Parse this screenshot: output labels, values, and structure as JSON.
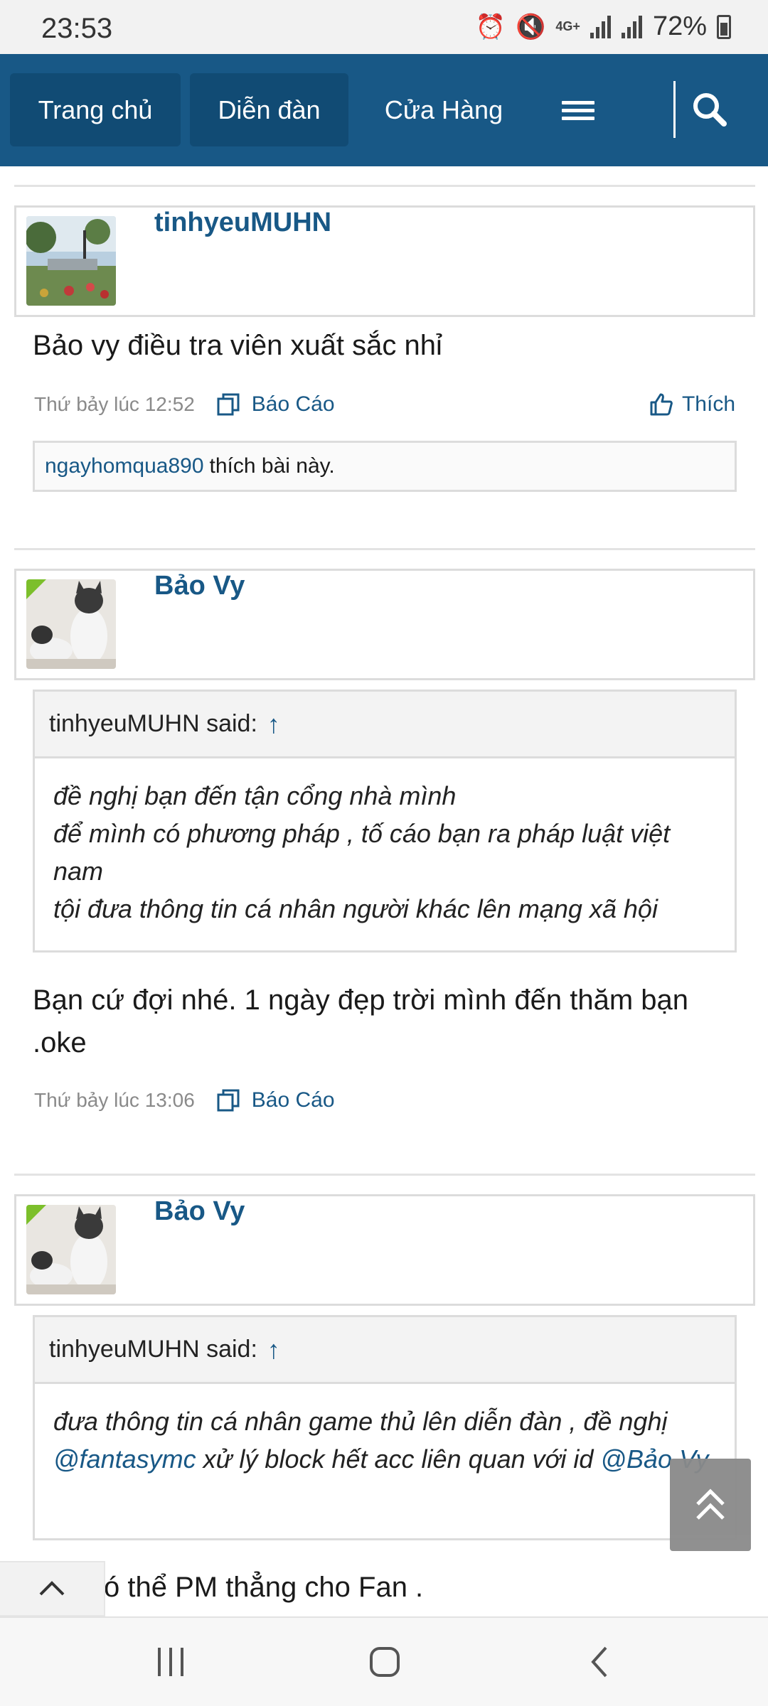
{
  "status_bar": {
    "time": "23:53",
    "network": "4G+",
    "battery": "72%",
    "icons": [
      "alarm-icon",
      "mute-icon",
      "data-icon",
      "signal-icon",
      "signal-icon",
      "battery-icon"
    ]
  },
  "nav": {
    "tabs": [
      {
        "label": "Trang chủ",
        "active": true
      },
      {
        "label": "Diễn đàn",
        "active": true
      },
      {
        "label": "Cửa Hàng",
        "active": false
      }
    ],
    "menu_icon": "hamburger-icon",
    "search_icon": "search-icon"
  },
  "posts": [
    {
      "username": "tinhyeuMUHN",
      "text": "Bảo vy điều tra viên xuất sắc nhỉ",
      "time": "Thứ bảy lúc 12:52",
      "report_label": "Báo Cáo",
      "like_label": "Thích",
      "likes": {
        "user": "ngayhomqua890",
        "text": "thích bài này."
      }
    },
    {
      "username": "Bảo Vy",
      "quote": {
        "author": "tinhyeuMUHN said:",
        "arrow": "↑",
        "lines": [
          "đề nghị bạn đến tận cổng nhà mình",
          "để mình có phương pháp , tố cáo bạn ra pháp luật việt nam",
          "tội đưa thông tin cá nhân người khác lên mạng xã hội"
        ]
      },
      "text": "Bạn cứ đợi nhé. 1 ngày đẹp trời mình đến thăm bạn .oke",
      "time": "Thứ bảy lúc 13:06",
      "report_label": "Báo Cáo"
    },
    {
      "username": "Bảo Vy",
      "quote": {
        "author": "tinhyeuMUHN said:",
        "arrow": "↑",
        "text_before": "đưa thông tin cá nhân game thủ lên diễn đàn , đề nghị ",
        "mention1": "@fantasymc",
        "text_middle": " xử lý block hết acc liên quan với id ",
        "mention2": "@Bảo Vy"
      },
      "text_partial": "ó thể PM thẳng cho Fan ."
    }
  ],
  "floating": {
    "scroll_top_icon": "double-chevron-up-icon",
    "collapse_icon": "chevron-up-icon"
  },
  "system_nav": [
    "recents-icon",
    "home-icon",
    "back-icon"
  ]
}
